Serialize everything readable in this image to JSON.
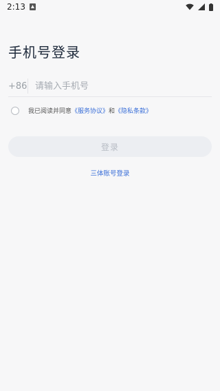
{
  "status_bar": {
    "time": "2:13"
  },
  "page": {
    "title": "手机号登录"
  },
  "phone": {
    "country_code": "+86",
    "placeholder": "请输入手机号",
    "value": ""
  },
  "agreement": {
    "prefix": "我已阅读并同意",
    "service_link": "《服务协议》",
    "and": "和",
    "privacy_link": "《隐私条款》"
  },
  "login_button": {
    "label": "登录"
  },
  "alt_login": {
    "label": "三体账号登录"
  },
  "colors": {
    "link": "#3a6fd8",
    "title": "#1e2a3b",
    "button_bg": "#eceef2"
  }
}
